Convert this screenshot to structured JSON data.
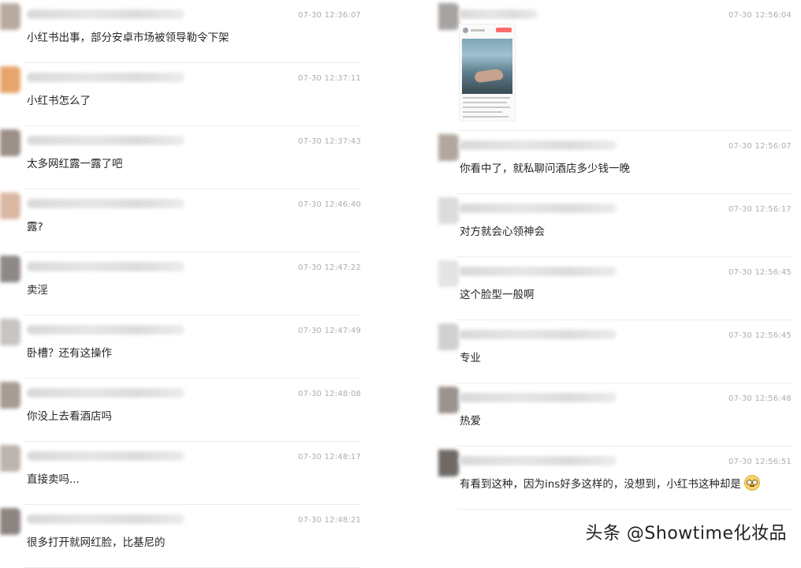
{
  "left_messages": [
    {
      "time": "07-30 12:36:07",
      "text": "小红书出事，部分安卓市场被领导勒令下架",
      "avatar_color": "#b9aaa0"
    },
    {
      "time": "07-30 12:37:11",
      "text": "小红书怎么了",
      "avatar_color": "#e7a46b"
    },
    {
      "time": "07-30 12:37:43",
      "text": "太多网红露一露了吧",
      "avatar_color": "#9c8f87"
    },
    {
      "time": "07-30 12:46:40",
      "text": "露?",
      "avatar_color": "#d9b8a4"
    },
    {
      "time": "07-30 12:47:22",
      "text": "卖淫",
      "avatar_color": "#8f8986"
    },
    {
      "time": "07-30 12:47:49",
      "text": "卧槽？还有这操作",
      "avatar_color": "#c9c4c2"
    },
    {
      "time": "07-30 12:48:08",
      "text": "你没上去看酒店吗",
      "avatar_color": "#a79b94"
    },
    {
      "time": "07-30 12:48:17",
      "text": "直接卖吗...",
      "avatar_color": "#bdb4ae"
    },
    {
      "time": "07-30 12:48:21",
      "text": "很多打开就网红脸，比基尼的",
      "avatar_color": "#8c8480"
    }
  ],
  "right_image_message": {
    "time": "07-30 12:56:04",
    "avatar_color": "#a7a3a0"
  },
  "right_messages": [
    {
      "time": "07-30 12:56:07",
      "text": "你看中了，就私聊问酒店多少钱一晚",
      "avatar_color": "#b3a79d"
    },
    {
      "time": "07-30 12:56:17",
      "text": "对方就会心领神会",
      "avatar_color": "#dcdcdc"
    },
    {
      "time": "07-30 12:56:45",
      "text": "这个脸型一般啊",
      "avatar_color": "#e4e4e4"
    },
    {
      "time": "07-30 12:56:45",
      "text": "专业",
      "avatar_color": "#d0d0d0"
    },
    {
      "time": "07-30 12:56:48",
      "text": "热爱",
      "avatar_color": "#9a928d"
    },
    {
      "time": "07-30 12:56:51",
      "text": "有看到这种，因为ins好多这样的，没想到，小红书这种却是",
      "avatar_color": "#6f6a66",
      "emoji": "flushed-face-icon"
    }
  ],
  "watermark": "头条 @Showtime化妆品"
}
